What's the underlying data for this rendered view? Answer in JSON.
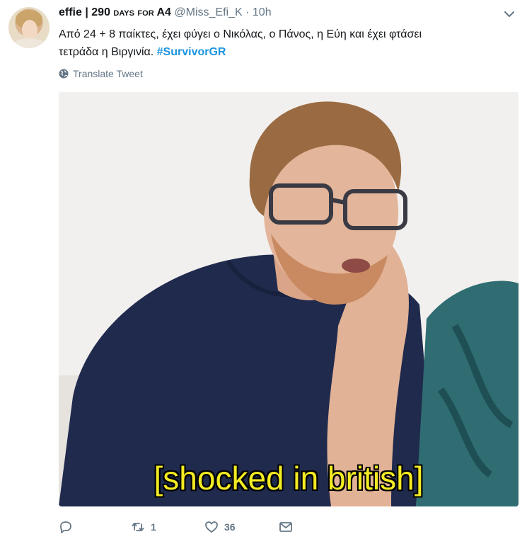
{
  "tweet": {
    "display_name": "effie | 290",
    "display_name_caps": "days for",
    "display_name_tail": "A4",
    "handle": "@Miss_Efi_K",
    "separator": "·",
    "time": "10h",
    "text_line1": "Από 24 + 8 παίκτες, έχει φύγει ο Νικόλας, ο Πάνος, η Εύη και έχει φτάσει",
    "text_line2": "τετράδα η Βιργινία.",
    "hashtag": "#SurvivorGR",
    "translate_label": "Translate Tweet",
    "media_caption": "[shocked in british]",
    "retweet_count": "1",
    "like_count": "36",
    "link_color": "#1b95e0",
    "muted_color": "#657786",
    "icons": [
      "chevron-down-icon",
      "globe-icon",
      "reply-icon",
      "retweet-icon",
      "like-icon",
      "dm-icon"
    ]
  }
}
